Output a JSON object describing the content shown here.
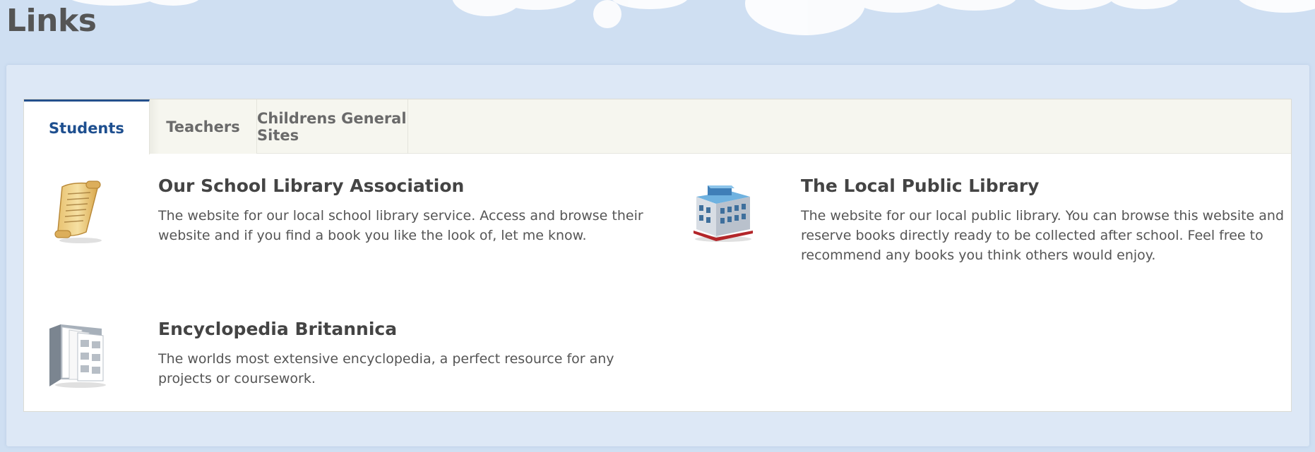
{
  "page": {
    "title": "Links"
  },
  "tabs": [
    {
      "label": "Students",
      "active": true
    },
    {
      "label": "Teachers",
      "active": false
    },
    {
      "label": "Childrens General Sites",
      "active": false
    }
  ],
  "links": [
    {
      "icon": "scroll-icon",
      "title": "Our School Library Association",
      "description": "The website for our local school library service. Access and browse their website and if you find a book you like the look of, let me know."
    },
    {
      "icon": "library-building-icon",
      "title": "The Local Public Library",
      "description": "The website for our local public library. You can browse this website and reserve books directly ready to be collected after school. Feel free to recommend any books you think others would enjoy."
    },
    {
      "icon": "book-icon",
      "title": "Encyclopedia Britannica",
      "description": "The worlds most extensive encyclopedia, a perfect resource for any projects or coursework."
    }
  ],
  "colors": {
    "background": "#cfdff2",
    "panel": "#dde8f6",
    "active_tab_text": "#1e4f8f",
    "active_tab_border": "#23508c",
    "tab_strip": "#f6f6ef"
  }
}
